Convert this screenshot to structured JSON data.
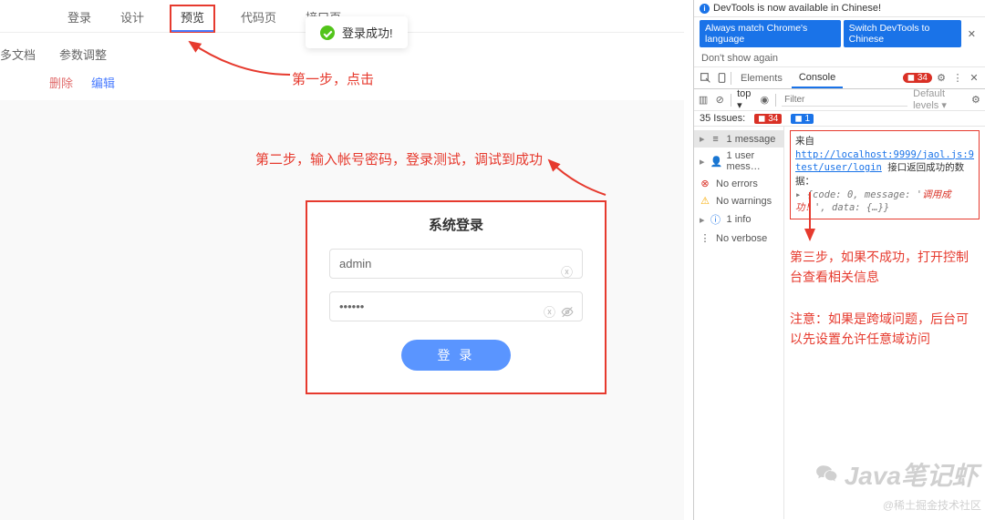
{
  "tabs": {
    "t0": "登录",
    "t1": "设计",
    "t2": "预览",
    "t3": "代码页",
    "t4": "接口页"
  },
  "toast": {
    "text": "登录成功!"
  },
  "secondrow": {
    "more_docs": "多文档",
    "param_adjust": "参数调整"
  },
  "thirdrow": {
    "del": "删除",
    "edit": "编辑"
  },
  "ann": {
    "step1": "第一步，点击",
    "step2": "第二步，输入帐号密码，登录测试，调试到成功",
    "step3_a": "第三步，如果不成功，打开控制台查看相关信息",
    "step3_b": "注意：如果是跨域问题，后台可以先设置允许任意域访问"
  },
  "login": {
    "title": "系统登录",
    "username": "admin",
    "password": "••••••",
    "button": "登 录"
  },
  "devtools": {
    "banner": "DevTools is now available in Chinese!",
    "btn1": "Always match Chrome's language",
    "btn2": "Switch DevTools to Chinese",
    "dont": "Don't show again",
    "tabs": {
      "elements": "Elements",
      "console": "Console"
    },
    "err_badge": "34",
    "toolbar": {
      "top": "top ▾",
      "filter_ph": "Filter",
      "levels": "Default levels ▾"
    },
    "issues": {
      "label": "35 Issues:",
      "red": "34",
      "blue": "1"
    },
    "sidebar": {
      "msg": "1 message",
      "usermsg": "1 user mess…",
      "noerr": "No errors",
      "nowarn": "No warnings",
      "info": "1 info",
      "noverb": "No verbose"
    },
    "console_block": {
      "from": "来自",
      "url": "http://localhost:9999/jaol.js:9",
      "path": "test/user/login",
      "label": "接口返回成功的数据：",
      "obj_pre": "{code: 0, message: '",
      "obj_msg": "调用成功！",
      "obj_post": "', data: {…}}"
    }
  },
  "watermark": {
    "main": "Java笔记虾",
    "sub": "@稀土掘金技术社区"
  }
}
